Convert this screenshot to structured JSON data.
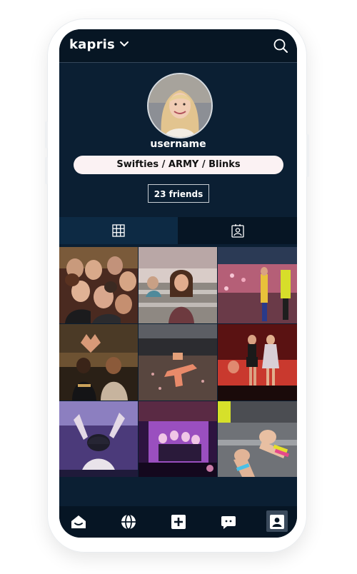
{
  "header": {
    "brand": "kapris",
    "brand_menu_icon": "chevron-down-icon",
    "search_icon": "search-icon"
  },
  "profile": {
    "username": "username",
    "fandoms": "Swifties / ARMY / Blinks",
    "friends": "23 friends"
  },
  "tabs": [
    {
      "icon": "grid-icon",
      "selected": true
    },
    {
      "icon": "tagged-person-icon",
      "selected": false
    }
  ],
  "posts": [
    {
      "subject": "group-selfie-concert"
    },
    {
      "subject": "girl-in-stadium-seats"
    },
    {
      "subject": "stadium-crowd-performer"
    },
    {
      "subject": "fans-making-heart"
    },
    {
      "subject": "stadium-stage-aerial"
    },
    {
      "subject": "performers-on-red-stage"
    },
    {
      "subject": "fan-raising-arms"
    },
    {
      "subject": "group-on-purple-screen"
    },
    {
      "subject": "hands-with-wristbands"
    }
  ],
  "bottom_nav": [
    {
      "icon": "home-icon",
      "selected": false
    },
    {
      "icon": "globe-icon",
      "selected": false
    },
    {
      "icon": "add-post-icon",
      "selected": false
    },
    {
      "icon": "messages-icon",
      "selected": false
    },
    {
      "icon": "profile-icon",
      "selected": true
    }
  ],
  "colors": {
    "screen_bg": "#0b1f33",
    "topbar_bg": "#071624",
    "fandom_pill": "#fbf2f3",
    "text": "#ffffff"
  }
}
